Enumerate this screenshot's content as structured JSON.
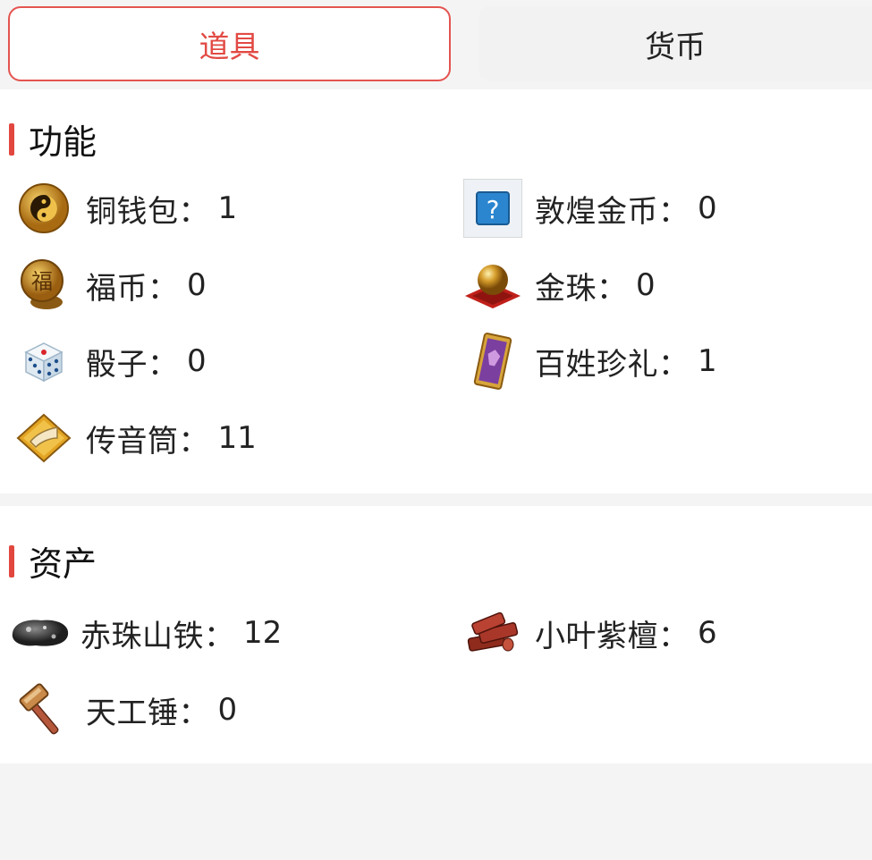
{
  "tabs": {
    "items": [
      "道具",
      "货币"
    ],
    "active": "道具"
  },
  "sections": [
    {
      "title": "功能",
      "items": [
        {
          "name": "铜钱包",
          "count": "1",
          "icon": "yin-yang-coin-icon"
        },
        {
          "name": "敦煌金币",
          "count": "0",
          "icon": "unknown-item-icon"
        },
        {
          "name": "福币",
          "count": "0",
          "icon": "fu-coin-icon"
        },
        {
          "name": "金珠",
          "count": "0",
          "icon": "gold-pearl-icon"
        },
        {
          "name": "骰子",
          "count": "0",
          "icon": "dice-icon"
        },
        {
          "name": "百姓珍礼",
          "count": "1",
          "icon": "gift-card-icon"
        },
        {
          "name": "传音筒",
          "count": "11",
          "icon": "horn-icon"
        }
      ]
    },
    {
      "title": "资产",
      "items": [
        {
          "name": "赤珠山铁",
          "count": "12",
          "icon": "iron-ore-icon"
        },
        {
          "name": "小叶紫檀",
          "count": "6",
          "icon": "wood-logs-icon"
        },
        {
          "name": "天工锤",
          "count": "0",
          "icon": "hammer-icon"
        }
      ]
    }
  ],
  "separator": "：",
  "colors": {
    "accent": "#e24a44",
    "section_bar": "#e2473f",
    "page_bg": "#f4f4f4",
    "card_bg": "#ffffff"
  }
}
